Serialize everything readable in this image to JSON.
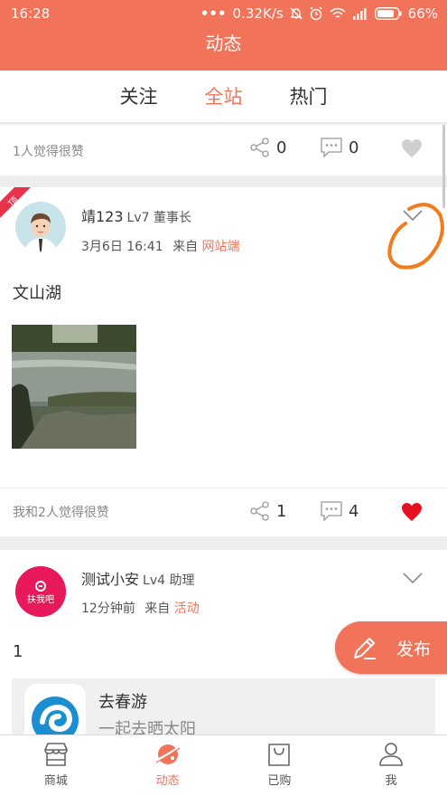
{
  "status_bar": {
    "time": "16:28",
    "speed": "0.32K/s",
    "battery": "66%"
  },
  "header": {
    "title": "动态"
  },
  "tabs": [
    {
      "label": "关注",
      "active": false
    },
    {
      "label": "全站",
      "active": true
    },
    {
      "label": "热门",
      "active": false
    }
  ],
  "top_strip": {
    "likes_text": "1人觉得很赞",
    "shares": "0",
    "comments": "0",
    "liked": false
  },
  "posts": [
    {
      "user": "靖123",
      "level": "Lv7 董事长",
      "time": "3月6日 16:41",
      "from_prefix": "来自",
      "source": "网站端",
      "text": "文山湖",
      "likes_text": "我和2人觉得很赞",
      "shares": "1",
      "comments": "4",
      "liked": true,
      "pinned": true
    },
    {
      "user": "测试小安",
      "level": "Lv4 助理",
      "time": "12分钟前",
      "from_prefix": "来自",
      "source": "活动",
      "text": "1",
      "avatar_text": "扶我吧",
      "link": {
        "title": "去春游",
        "subtitle": "一起去晒太阳"
      }
    }
  ],
  "fab": {
    "label": "发布"
  },
  "bottom_nav": [
    {
      "label": "商城",
      "icon": "shop-icon",
      "active": false
    },
    {
      "label": "动态",
      "icon": "planet-icon",
      "active": true
    },
    {
      "label": "已购",
      "icon": "bag-icon",
      "active": false
    },
    {
      "label": "我",
      "icon": "person-icon",
      "active": false
    }
  ],
  "colors": {
    "accent": "#f0735a",
    "heart": "#e81123",
    "annotation": "#f07c1e"
  }
}
